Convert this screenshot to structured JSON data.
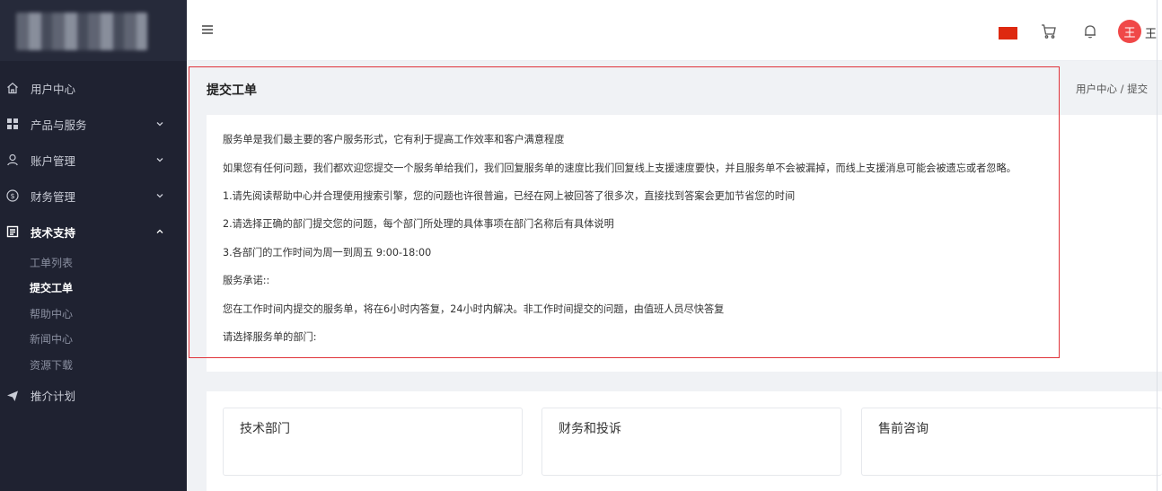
{
  "sidebar": {
    "menu": [
      {
        "label": "用户中心",
        "icon": "home-icon",
        "has_chevron": false
      },
      {
        "label": "产品与服务",
        "icon": "grid-icon",
        "has_chevron": true
      },
      {
        "label": "账户管理",
        "icon": "user-icon",
        "has_chevron": true
      },
      {
        "label": "财务管理",
        "icon": "dollar-icon",
        "has_chevron": true
      },
      {
        "label": "技术支持",
        "icon": "document-icon",
        "has_chevron": true,
        "expanded": true
      }
    ],
    "submenu": [
      {
        "label": "工单列表"
      },
      {
        "label": "提交工单",
        "active": true
      },
      {
        "label": "帮助中心"
      },
      {
        "label": "新闻中心"
      },
      {
        "label": "资源下载"
      }
    ],
    "extra_menu": {
      "label": "推介计划",
      "icon": "send-icon"
    }
  },
  "header": {
    "avatar_text": "王",
    "username": "王",
    "accent_color": "#f04848",
    "flag_color": "#de2910"
  },
  "page": {
    "title": "提交工单",
    "breadcrumb": "用户中心 / 提交"
  },
  "info": {
    "lines": [
      "服务单是我们最主要的客户服务形式，它有利于提高工作效率和客户满意程度",
      "如果您有任何问题，我们都欢迎您提交一个服务单给我们，我们回复服务单的速度比我们回复线上支援速度要快，并且服务单不会被漏掉，而线上支援消息可能会被遗忘或者忽略。",
      "1.请先阅读帮助中心并合理使用搜索引擎，您的问题也许很普遍，已经在网上被回答了很多次，直接找到答案会更加节省您的时间",
      "2.请选择正确的部门提交您的问题，每个部门所处理的具体事项在部门名称后有具体说明",
      "3.各部门的工作时间为周一到周五 9:00-18:00",
      "服务承诺::",
      "您在工作时间内提交的服务单，将在6小时内答复，24小时内解决。非工作时间提交的问题，由值班人员尽快答复",
      "请选择服务单的部门:"
    ]
  },
  "departments": [
    {
      "name": "技术部门"
    },
    {
      "name": "财务和投诉"
    },
    {
      "name": "售前咨询"
    }
  ]
}
